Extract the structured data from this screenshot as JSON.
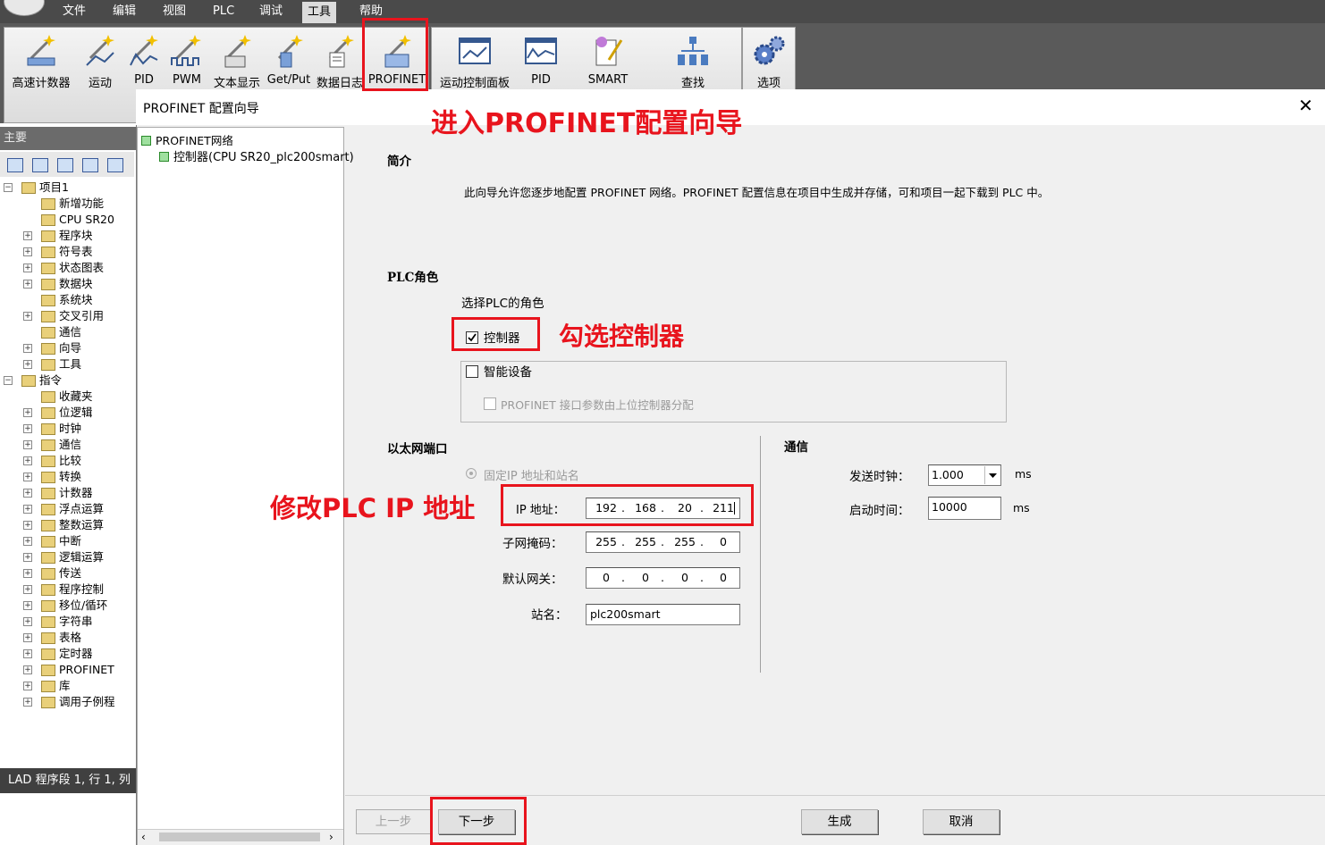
{
  "menubar": {
    "items": [
      "文件",
      "编辑",
      "视图",
      "PLC",
      "调试",
      "工具",
      "帮助"
    ],
    "active": "工具"
  },
  "ribbon": {
    "tools": [
      "高速计数器",
      "运动",
      "PID",
      "PWM",
      "文本显示",
      "Get/Put",
      "数据日志",
      "PROFINET"
    ],
    "panels": [
      "运动控制面板",
      "PID",
      "SMART",
      "查找"
    ],
    "options": "选项"
  },
  "left_panel": {
    "header": "主要",
    "tree": [
      {
        "label": "项目1",
        "level": 0,
        "expand": "−"
      },
      {
        "label": "新增功能",
        "level": 1,
        "expand": ""
      },
      {
        "label": "CPU SR20",
        "level": 1,
        "expand": ""
      },
      {
        "label": "程序块",
        "level": 1,
        "expand": "+"
      },
      {
        "label": "符号表",
        "level": 1,
        "expand": "+"
      },
      {
        "label": "状态图表",
        "level": 1,
        "expand": "+"
      },
      {
        "label": "数据块",
        "level": 1,
        "expand": "+"
      },
      {
        "label": "系统块",
        "level": 1,
        "expand": ""
      },
      {
        "label": "交叉引用",
        "level": 1,
        "expand": "+"
      },
      {
        "label": "通信",
        "level": 1,
        "expand": ""
      },
      {
        "label": "向导",
        "level": 1,
        "expand": "+"
      },
      {
        "label": "工具",
        "level": 1,
        "expand": "+"
      },
      {
        "label": "指令",
        "level": 0,
        "expand": "−"
      },
      {
        "label": "收藏夹",
        "level": 1,
        "expand": ""
      },
      {
        "label": "位逻辑",
        "level": 1,
        "expand": "+"
      },
      {
        "label": "时钟",
        "level": 1,
        "expand": "+"
      },
      {
        "label": "通信",
        "level": 1,
        "expand": "+"
      },
      {
        "label": "比较",
        "level": 1,
        "expand": "+"
      },
      {
        "label": "转换",
        "level": 1,
        "expand": "+"
      },
      {
        "label": "计数器",
        "level": 1,
        "expand": "+"
      },
      {
        "label": "浮点运算",
        "level": 1,
        "expand": "+"
      },
      {
        "label": "整数运算",
        "level": 1,
        "expand": "+"
      },
      {
        "label": "中断",
        "level": 1,
        "expand": "+"
      },
      {
        "label": "逻辑运算",
        "level": 1,
        "expand": "+"
      },
      {
        "label": "传送",
        "level": 1,
        "expand": "+"
      },
      {
        "label": "程序控制",
        "level": 1,
        "expand": "+"
      },
      {
        "label": "移位/循环",
        "level": 1,
        "expand": "+"
      },
      {
        "label": "字符串",
        "level": 1,
        "expand": "+"
      },
      {
        "label": "表格",
        "level": 1,
        "expand": "+"
      },
      {
        "label": "定时器",
        "level": 1,
        "expand": "+"
      },
      {
        "label": "PROFINET",
        "level": 1,
        "expand": "+"
      },
      {
        "label": "库",
        "level": 1,
        "expand": "+"
      },
      {
        "label": "调用子例程",
        "level": 1,
        "expand": "+"
      }
    ],
    "status": "LAD 程序段 1, 行 1, 列"
  },
  "dialog": {
    "title": "PROFINET 配置向导",
    "close": "✕",
    "nav": {
      "root": "PROFINET网络",
      "child": "控制器(CPU SR20_plc200smart)"
    },
    "intro_heading": "简介",
    "intro_text": "此向导允许您逐步地配置 PROFINET 网络。PROFINET 配置信息在项目中生成并存储，可和项目一起下载到 PLC 中。",
    "role_heading": "PLC角色",
    "role_prompt": "选择PLC的角色",
    "controller_label": "控制器",
    "controller_checked": true,
    "smart_device_label": "智能设备",
    "smart_device_checked": false,
    "profinet_assign_label": "PROFINET 接口参数由上位控制器分配",
    "eth_heading": "以太网端口",
    "fixed_ip_label": "固定IP 地址和站名",
    "ip_label": "IP 地址：",
    "ip": [
      "192",
      "168",
      "20",
      "211"
    ],
    "mask_label": "子网掩码：",
    "mask": [
      "255",
      "255",
      "255",
      "0"
    ],
    "gateway_label": "默认网关：",
    "gateway": [
      "0",
      "0",
      "0",
      "0"
    ],
    "station_label": "站名：",
    "station_value": "plc200smart",
    "comm_heading": "通信",
    "send_clock_label": "发送时钟：",
    "send_clock_value": "1.000",
    "send_clock_unit": "ms",
    "startup_label": "启动时间：",
    "startup_value": "10000",
    "startup_unit": "ms",
    "buttons": {
      "prev": "上一步",
      "next": "下一步",
      "generate": "生成",
      "cancel": "取消"
    }
  },
  "annotations": {
    "enter_wizard": "进入PROFINET配置向导",
    "check_controller": "勾选控制器",
    "modify_ip": "修改PLC IP 地址"
  },
  "colors": {
    "annotation_red": "#e8141d",
    "menubar": "#4a4a4a"
  }
}
